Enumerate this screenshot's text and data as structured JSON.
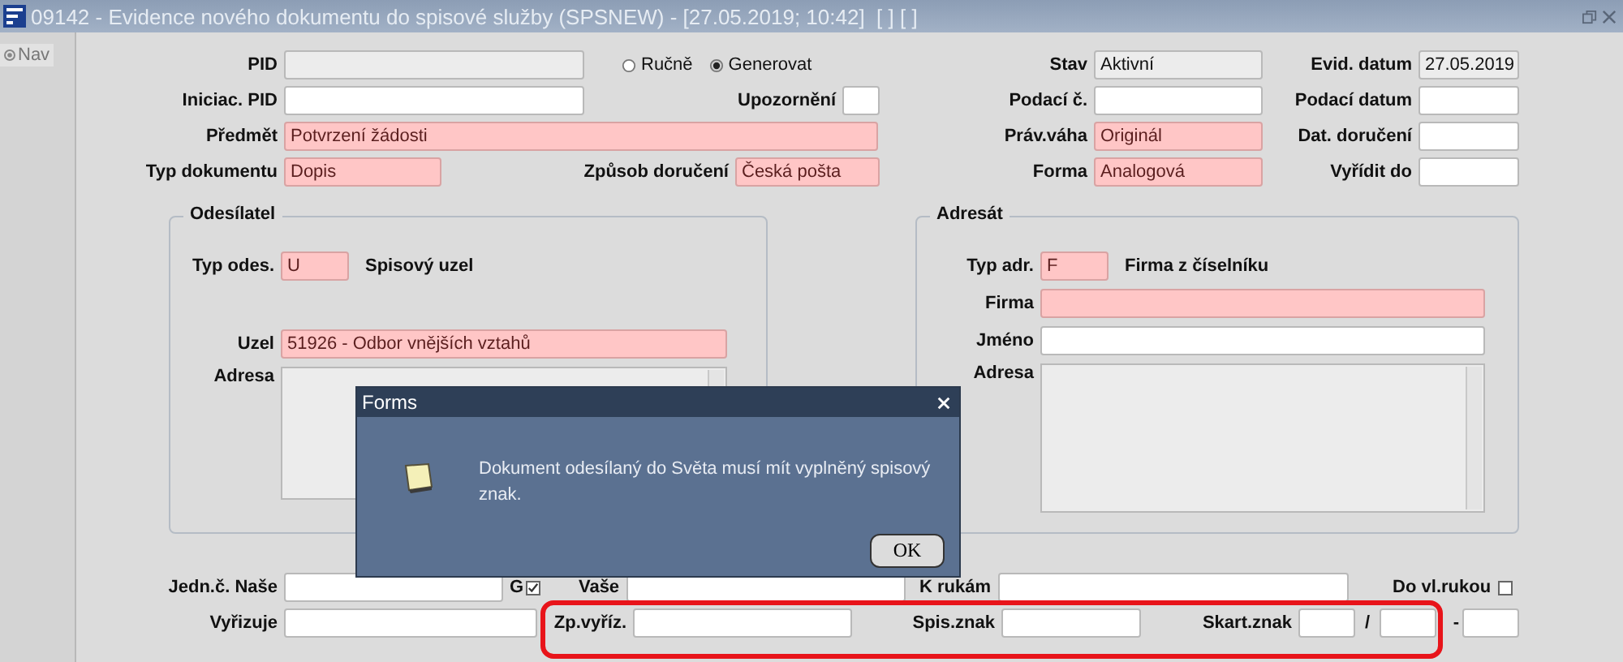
{
  "window": {
    "title": "09142 - Evidence nového dokumentu do spisové služby (SPSNEW) - [27.05.2019; 10:42]  [ ] [ ]"
  },
  "nav": {
    "label": "Nav"
  },
  "header": {
    "pid": {
      "label": "PID",
      "kind": "readonly"
    },
    "pid_mode": [
      {
        "label": "Ručně",
        "selected": false
      },
      {
        "label": "Generovat",
        "selected": true
      }
    ],
    "stav": {
      "label": "Stav",
      "value": "Aktivní",
      "kind": "readonly"
    },
    "evid_datum": {
      "label": "Evid. datum",
      "value": "27.05.2019",
      "kind": "readonly"
    },
    "iniciac_pid": {
      "label": "Iniciac. PID",
      "kind": "normal"
    },
    "upozorneni": {
      "label": "Upozornění",
      "kind": "normal"
    },
    "podaci_c": {
      "label": "Podací č.",
      "kind": "normal"
    },
    "podaci_datum": {
      "label": "Podací datum",
      "kind": "normal"
    },
    "predmet": {
      "label": "Předmět",
      "value": "Potvrzení žádosti",
      "kind": "required"
    },
    "prav_vaha": {
      "label": "Práv.váha",
      "value": "Originál",
      "kind": "required"
    },
    "dat_doruceni": {
      "label": "Dat. doručení",
      "kind": "normal"
    },
    "typ_dokumentu": {
      "label": "Typ dokumentu",
      "value": "Dopis",
      "kind": "required"
    },
    "zpusob_doruceni": {
      "label": "Způsob doručení",
      "value": "Česká pošta",
      "kind": "required"
    },
    "forma": {
      "label": "Forma",
      "value": "Analogová",
      "kind": "required"
    },
    "vyridit_do": {
      "label": "Vyřídit do",
      "kind": "normal"
    }
  },
  "odesilatel": {
    "title": "Odesílatel",
    "typ": {
      "label": "Typ odes.",
      "value": "U",
      "kind": "required"
    },
    "typ_name": "Spisový uzel",
    "uzel": {
      "label": "Uzel",
      "value": "51926 - Odbor vnějších vztahů",
      "kind": "required"
    },
    "adresa": {
      "label": "Adresa",
      "kind": "readonly"
    }
  },
  "adresat": {
    "title": "Adresát",
    "typ": {
      "label": "Typ adr.",
      "value": "F",
      "kind": "required"
    },
    "typ_name": "Firma z číselníku",
    "firma": {
      "label": "Firma",
      "kind": "required"
    },
    "jmeno": {
      "label": "Jméno",
      "kind": "normal"
    },
    "adresa": {
      "label": "Adresa",
      "kind": "readonly"
    }
  },
  "bottom": {
    "jedn_nase": {
      "label": "Jedn.č. Naše",
      "kind": "normal"
    },
    "g": {
      "label": "G",
      "checked": true
    },
    "vase": {
      "label": "Vaše",
      "kind": "normal"
    },
    "k_rukam": {
      "label": "K rukám",
      "kind": "normal"
    },
    "do_vl_rukou": {
      "label": "Do vl.rukou",
      "checked": false
    },
    "vyrizuje": {
      "label": "Vyřizuje",
      "kind": "normal"
    },
    "zp_vyriz": {
      "label": "Zp.vyříz.",
      "kind": "normal"
    },
    "spis_znak": {
      "label": "Spis.znak",
      "kind": "normal"
    },
    "skart_znak": {
      "label": "Skart.znak",
      "parts": [
        {
          "kind": "normal"
        },
        {
          "kind": "normal"
        },
        {
          "kind": "normal"
        }
      ],
      "separators": [
        "/",
        "-"
      ]
    }
  },
  "dialog": {
    "title": "Forms",
    "message": "Dokument odesílaný do Světa musí mít vyplněný spisový znak.",
    "button": "OK"
  }
}
